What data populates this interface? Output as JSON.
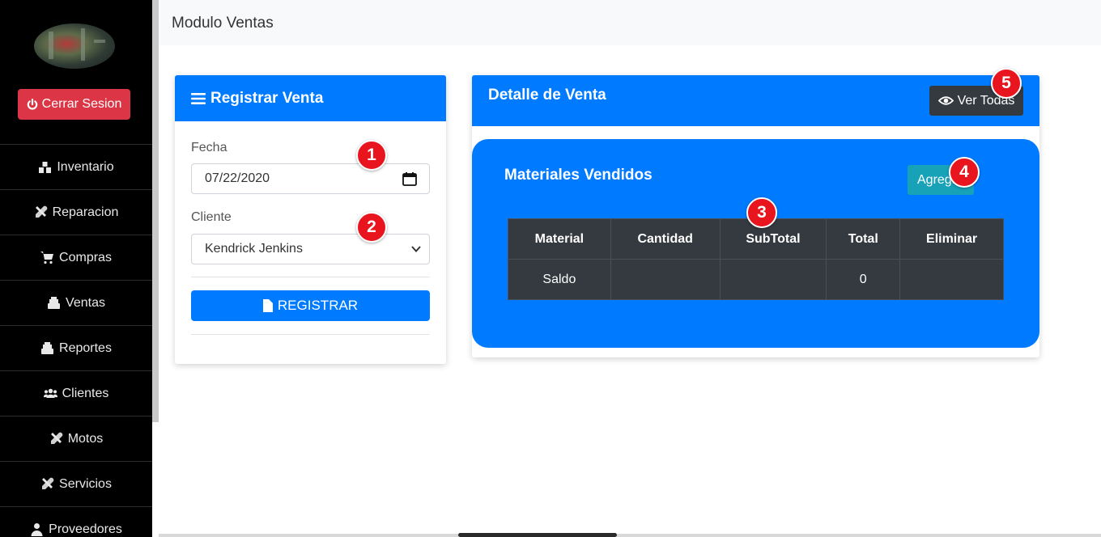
{
  "sidebar": {
    "logout_label": "Cerrar Sesion",
    "items": [
      {
        "label": "Inventario",
        "icon": "warehouse-icon"
      },
      {
        "label": "Reparacion",
        "icon": "tools-icon"
      },
      {
        "label": "Compras",
        "icon": "cart-icon"
      },
      {
        "label": "Ventas",
        "icon": "cash-register-icon"
      },
      {
        "label": "Reportes",
        "icon": "cash-register-icon"
      },
      {
        "label": "Clientes",
        "icon": "users-icon"
      },
      {
        "label": "Motos",
        "icon": "tools-icon"
      },
      {
        "label": "Servicios",
        "icon": "tools-icon"
      },
      {
        "label": "Proveedores",
        "icon": "user-tie-icon"
      }
    ]
  },
  "topbar": {
    "title": "Modulo Ventas"
  },
  "register_card": {
    "title": "Registrar Venta",
    "date_label": "Fecha",
    "date_value": "07/22/2020",
    "client_label": "Cliente",
    "client_value": "Kendrick Jenkins",
    "submit_label": "REGISTRAR"
  },
  "detail_card": {
    "title": "Detalle de Venta",
    "view_all_label": "Ver Todas",
    "materials_title": "Materiales Vendidos",
    "add_label": "Agrega",
    "table": {
      "headers": [
        "Material",
        "Cantidad",
        "SubTotal",
        "Total",
        "Eliminar"
      ],
      "rows": [
        [
          "Saldo",
          "",
          "",
          "0",
          ""
        ]
      ]
    }
  },
  "markers": [
    "1",
    "2",
    "3",
    "4",
    "5"
  ],
  "colors": {
    "primary": "#007bff",
    "danger": "#dc3545",
    "dark": "#343a40",
    "info": "#17a2b8",
    "marker": "#e8141e"
  }
}
